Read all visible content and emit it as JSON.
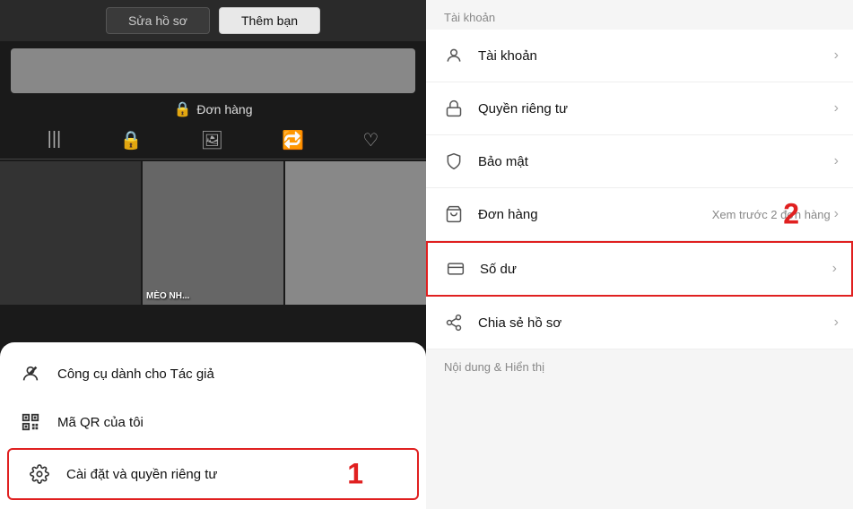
{
  "left": {
    "top_buttons": [
      {
        "label": "Sửa hồ sơ",
        "active": false
      },
      {
        "label": "Thêm bạn",
        "active": true
      }
    ],
    "order_label": "Đơn hàng",
    "icons": [
      "|||",
      "🔒",
      "🖼",
      "🔁",
      "♡"
    ],
    "photos": [
      {
        "type": "dark",
        "label": ""
      },
      {
        "type": "medium",
        "label": "MÈO NH..."
      },
      {
        "type": "light",
        "label": ""
      }
    ],
    "menu_items": [
      {
        "icon": "👤",
        "text": "Công cụ dành cho Tác giả",
        "highlighted": false
      },
      {
        "icon": "⊞",
        "text": "Mã QR của tôi",
        "highlighted": false
      },
      {
        "icon": "⚙",
        "text": "Cài đặt và quyền riêng tư",
        "highlighted": true
      }
    ],
    "number_1": "1"
  },
  "right": {
    "section_title": "Tài khoản",
    "items": [
      {
        "icon": "👤",
        "text": "Tài khoản",
        "sub": "",
        "highlighted": false
      },
      {
        "icon": "🔒",
        "text": "Quyền riêng tư",
        "sub": "",
        "highlighted": false
      },
      {
        "icon": "🛡",
        "text": "Bảo mật",
        "sub": "",
        "highlighted": false
      },
      {
        "icon": "🛍",
        "text": "Đơn hàng",
        "sub": "Xem trước 2 đơn hàng",
        "highlighted": false
      },
      {
        "icon": "💳",
        "text": "Số dư",
        "sub": "",
        "highlighted": true
      },
      {
        "icon": "↗",
        "text": "Chia sẻ hồ sơ",
        "sub": "",
        "highlighted": false
      }
    ],
    "section2_title": "Nội dung & Hiển thị",
    "number_2": "2"
  }
}
